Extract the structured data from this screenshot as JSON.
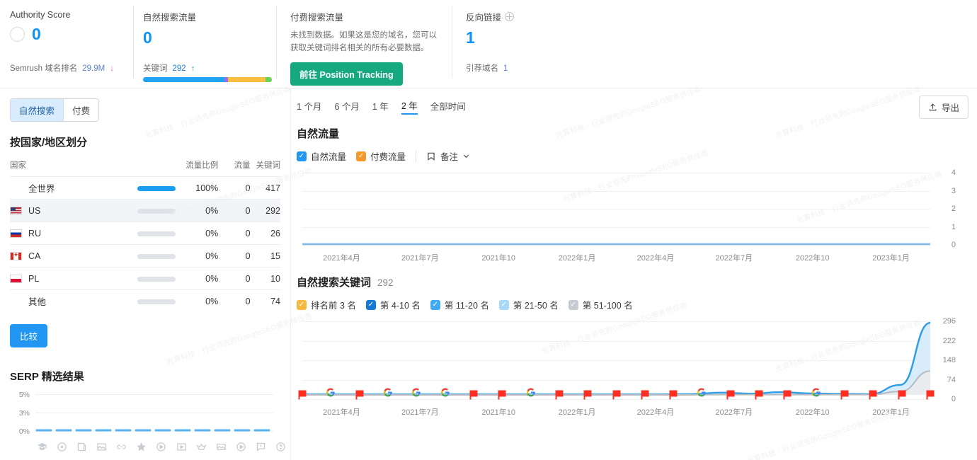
{
  "watermark": "光算科技 - 行业领先的GoogleSEO服务供应商",
  "header": {
    "authority": {
      "title": "Authority Score",
      "value": "0",
      "footer_label": "Semrush 域名排名",
      "footer_value": "29.9M",
      "footer_arrow": "↓"
    },
    "organic": {
      "title": "自然搜索流量",
      "value": "0",
      "footer_label": "关键词",
      "footer_value": "292",
      "footer_arrow": "↑",
      "bar_segments": [
        {
          "color": "#22a3f2",
          "pct": 63
        },
        {
          "color": "#9b6ee8",
          "pct": 3
        },
        {
          "color": "#f9bd3f",
          "pct": 29
        },
        {
          "color": "#68d35a",
          "pct": 5
        }
      ]
    },
    "paid": {
      "title": "付费搜索流量",
      "description": "未找到数据。如果这是您的域名，您可以获取关键词排名相关的所有必要数据。",
      "button": "前往 Position Tracking"
    },
    "backlinks": {
      "title": "反向链接",
      "icon": "globe-icon",
      "value": "1",
      "footer_label": "引荐域名",
      "footer_value": "1"
    }
  },
  "left": {
    "tabs": [
      {
        "label": "自然搜索",
        "active": true
      },
      {
        "label": "付费",
        "active": false
      }
    ],
    "section_title": "按国家/地区划分",
    "table": {
      "columns": [
        "国家",
        "",
        "流量比例",
        "流量",
        "关键词"
      ],
      "rows": [
        {
          "flag": "ww",
          "country": "全世界",
          "bar_full": true,
          "pct": "100%",
          "traffic": "0",
          "keywords": "417",
          "link": false,
          "highlight": false
        },
        {
          "flag": "us",
          "country": "US",
          "bar_full": false,
          "pct": "0%",
          "traffic": "0",
          "keywords": "292",
          "link": true,
          "highlight": true
        },
        {
          "flag": "ru",
          "country": "RU",
          "bar_full": false,
          "pct": "0%",
          "traffic": "0",
          "keywords": "26",
          "link": true,
          "highlight": false
        },
        {
          "flag": "ca",
          "country": "CA",
          "bar_full": false,
          "pct": "0%",
          "traffic": "0",
          "keywords": "15",
          "link": true,
          "highlight": false
        },
        {
          "flag": "pl",
          "country": "PL",
          "bar_full": false,
          "pct": "0%",
          "traffic": "0",
          "keywords": "10",
          "link": true,
          "highlight": false
        },
        {
          "flag": "ww",
          "country": "其他",
          "bar_full": false,
          "pct": "0%",
          "traffic": "0",
          "keywords": "74",
          "link": false,
          "highlight": false
        }
      ]
    },
    "compare_button": "比较",
    "serp": {
      "title": "SERP 精选结果",
      "y_ticks": [
        "5%",
        "3%",
        "0%"
      ],
      "icons": [
        "featured-snippet-icon",
        "local-pack-icon",
        "sitelinks-icon",
        "image-pack-icon",
        "link-icon",
        "reviews-icon",
        "video-icon",
        "featured-video-icon",
        "top-stories-icon",
        "carousel-icon",
        "video-player-icon",
        "faq-icon",
        "people-also-ask-icon"
      ]
    }
  },
  "right": {
    "ranges": [
      {
        "label": "1 个月",
        "active": false
      },
      {
        "label": "6 个月",
        "active": false
      },
      {
        "label": "1 年",
        "active": false
      },
      {
        "label": "2 年",
        "active": true
      },
      {
        "label": "全部时间",
        "active": false
      }
    ],
    "export_button": "导出",
    "export_icon": "upload-icon",
    "traffic_chart": {
      "title": "自然流量",
      "legend": [
        {
          "label": "自然流量",
          "color": "#2196f3",
          "checked": true
        },
        {
          "label": "付费流量",
          "color": "#f5992c",
          "checked": true
        }
      ],
      "notes_label": "备注",
      "notes_icon": "note-icon"
    },
    "keywords_chart": {
      "title": "自然搜索关键词",
      "count": "292",
      "legend": [
        {
          "label": "排名前 3 名",
          "color": "#f6b940",
          "checked": true
        },
        {
          "label": "第 4-10 名",
          "color": "#1579d6",
          "checked": true
        },
        {
          "label": "第 11-20 名",
          "color": "#41aaf0",
          "checked": true
        },
        {
          "label": "第 21-50 名",
          "color": "#a8d8f7",
          "checked": true
        },
        {
          "label": "第 51-100 名",
          "color": "#c7ccd2",
          "checked": true
        }
      ]
    }
  },
  "chart_data": [
    {
      "type": "line",
      "name": "自然流量",
      "title": "自然流量",
      "xlabel": "",
      "ylabel": "",
      "ylim": [
        0,
        4
      ],
      "y_ticks": [
        0,
        1,
        2,
        3,
        4
      ],
      "x_ticks": [
        "2021年4月",
        "2021年7月",
        "2021年10",
        "2022年1月",
        "2022年4月",
        "2022年7月",
        "2022年10",
        "2023年1月"
      ],
      "grid": true,
      "legend_position": "top-left",
      "series": [
        {
          "name": "自然流量",
          "color": "#2196f3",
          "x": [
            "2021年4月",
            "2021年7月",
            "2021年10",
            "2022年1月",
            "2022年4月",
            "2022年7月",
            "2022年10",
            "2023年1月"
          ],
          "values": [
            0,
            0,
            0,
            0,
            0,
            0,
            0,
            0
          ]
        },
        {
          "name": "付费流量",
          "color": "#f5992c",
          "x": [
            "2021年4月",
            "2021年7月",
            "2021年10",
            "2022年1月",
            "2022年4月",
            "2022年7月",
            "2022年10",
            "2023年1月"
          ],
          "values": [
            0,
            0,
            0,
            0,
            0,
            0,
            0,
            0
          ]
        }
      ]
    },
    {
      "type": "area",
      "name": "自然搜索关键词",
      "title": "自然搜索关键词",
      "xlabel": "",
      "ylabel": "",
      "ylim": [
        0,
        296
      ],
      "y_ticks": [
        0,
        74,
        148,
        222,
        296
      ],
      "x_ticks": [
        "2021年4月",
        "2021年7月",
        "2021年10",
        "2022年1月",
        "2022年4月",
        "2022年7月",
        "2022年10",
        "2023年1月"
      ],
      "grid": true,
      "legend_position": "top-left",
      "series": [
        {
          "name": "第 4-10 名",
          "color": "#41aaf0",
          "x": [
            "2021年4月",
            "2021年5月",
            "2021年6月",
            "2021年7月",
            "2021年8月",
            "2021年9月",
            "2021年10",
            "2021年11月",
            "2021年12月",
            "2022年1月",
            "2022年2月",
            "2022年3月",
            "2022年4月",
            "2022年5月",
            "2022年6月",
            "2022年7月",
            "2022年8月",
            "2022年9月",
            "2022年10",
            "2022年11月",
            "2022年12月",
            "2023年1月"
          ],
          "values": [
            2,
            2,
            2,
            2,
            2,
            2,
            2,
            2,
            2,
            2,
            2,
            2,
            2,
            3,
            9,
            5,
            11,
            6,
            4,
            3,
            40,
            290
          ]
        },
        {
          "name": "第 51-100 名",
          "color": "#c7ccd2",
          "x": [
            "2021年4月",
            "2021年5月",
            "2021年6月",
            "2021年7月",
            "2021年8月",
            "2021年9月",
            "2021年10",
            "2021年11月",
            "2021年12月",
            "2022年1月",
            "2022年2月",
            "2022年3月",
            "2022年4月",
            "2022年5月",
            "2022年6月",
            "2022年7月",
            "2022年8月",
            "2022年9月",
            "2022年10",
            "2022年11月",
            "2022年12月",
            "2023年1月"
          ],
          "values": [
            0,
            0,
            0,
            0,
            0,
            0,
            0,
            0,
            0,
            0,
            0,
            0,
            0,
            0,
            1,
            1,
            1,
            1,
            1,
            1,
            14,
            96
          ]
        }
      ],
      "markers": [
        {
          "type": "google-update-marker",
          "index": 0
        },
        {
          "type": "google-algo-marker",
          "index": 1
        },
        {
          "type": "google-update-marker",
          "index": 2
        },
        {
          "type": "google-algo-marker",
          "index": 3
        },
        {
          "type": "google-algo-marker",
          "index": 4
        },
        {
          "type": "google-algo-marker",
          "index": 5
        },
        {
          "type": "google-update-marker",
          "index": 6
        },
        {
          "type": "google-update-marker",
          "index": 7
        },
        {
          "type": "google-algo-marker",
          "index": 8
        },
        {
          "type": "google-update-marker",
          "index": 9
        },
        {
          "type": "google-update-marker",
          "index": 10
        },
        {
          "type": "google-update-marker",
          "index": 11
        },
        {
          "type": "google-update-marker",
          "index": 12
        },
        {
          "type": "google-update-marker",
          "index": 13
        },
        {
          "type": "google-algo-marker",
          "index": 14
        },
        {
          "type": "google-update-marker",
          "index": 15
        },
        {
          "type": "google-update-marker",
          "index": 16
        },
        {
          "type": "google-update-marker",
          "index": 17
        },
        {
          "type": "google-algo-marker",
          "index": 18
        },
        {
          "type": "google-update-marker",
          "index": 19
        },
        {
          "type": "google-update-marker",
          "index": 20
        },
        {
          "type": "google-update-marker",
          "index": 21
        },
        {
          "type": "google-update-marker",
          "index": 22
        }
      ]
    }
  ]
}
